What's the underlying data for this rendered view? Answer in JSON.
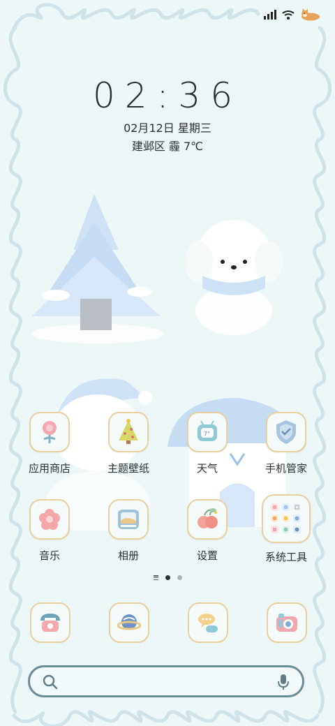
{
  "status": {
    "signal_icon": "signal-bars-icon",
    "wifi_icon": "wifi-icon",
    "battery_icon": "shiba-battery-icon"
  },
  "clock": {
    "time": "02:36",
    "date": "02月12日 星期三",
    "weather": "建邺区 霾 7℃"
  },
  "apps": [
    {
      "label": "应用商店",
      "icon": "app-store-flower-icon"
    },
    {
      "label": "主题壁纸",
      "icon": "theme-tree-icon"
    },
    {
      "label": "天气",
      "icon": "weather-tv-icon"
    },
    {
      "label": "手机管家",
      "icon": "shield-check-icon"
    },
    {
      "label": "音乐",
      "icon": "music-flower-icon"
    },
    {
      "label": "相册",
      "icon": "gallery-photo-icon"
    },
    {
      "label": "设置",
      "icon": "settings-cherry-icon"
    },
    {
      "label": "系统工具",
      "icon": "system-tools-folder-icon"
    }
  ],
  "dock": [
    {
      "icon": "phone-icon"
    },
    {
      "icon": "browser-planet-icon"
    },
    {
      "icon": "messages-bubble-icon"
    },
    {
      "icon": "camera-icon"
    }
  ],
  "pager": {
    "pages": 2,
    "active": 1
  },
  "colors": {
    "background": "#eef7f8",
    "tile_border": "#e8cf9e",
    "search_border": "#6e8c98",
    "frame": "#c9dfe6"
  }
}
